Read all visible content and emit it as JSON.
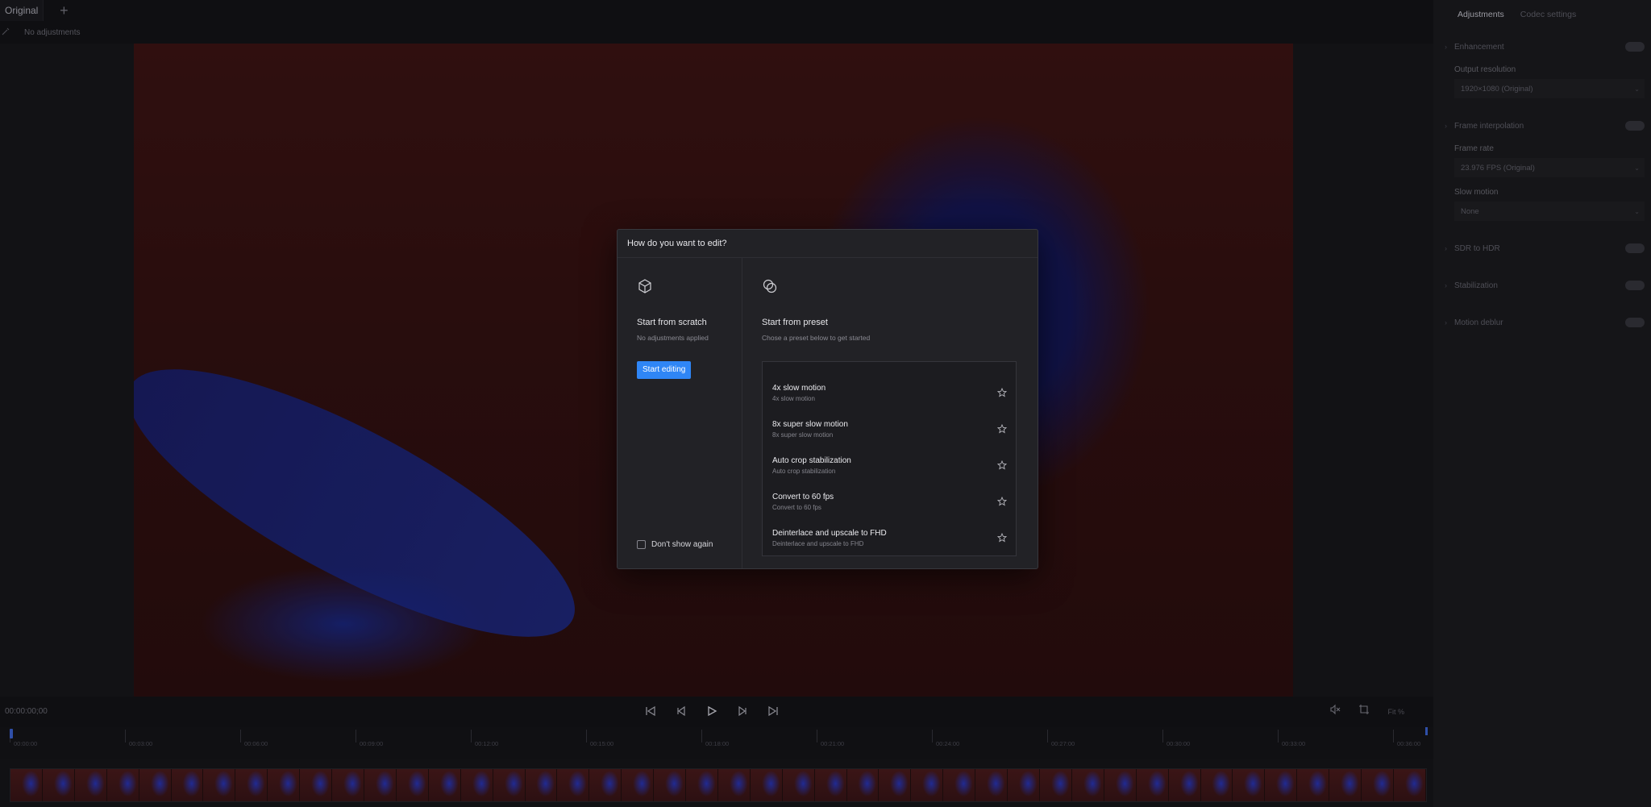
{
  "tabs": {
    "original_label": "Original",
    "add_symbol": "+"
  },
  "subbar": {
    "adjustments_label": "No adjustments"
  },
  "dialog": {
    "title": "How do you want to edit?",
    "scratch": {
      "title": "Start from scratch",
      "subtitle": "No adjustments applied",
      "button": "Start editing",
      "icon": "cube-icon"
    },
    "preset": {
      "title": "Start from preset",
      "subtitle": "Chose a preset below to get started",
      "icon": "circles-icon",
      "items": [
        {
          "name": "4x slow motion",
          "desc": "4x slow motion"
        },
        {
          "name": "8x super slow motion",
          "desc": "8x super slow motion"
        },
        {
          "name": "Auto crop stabilization",
          "desc": "Auto crop stabilization"
        },
        {
          "name": "Convert to 60 fps",
          "desc": "Convert to 60 fps"
        },
        {
          "name": "Deinterlace and upscale to FHD",
          "desc": "Deinterlace and upscale to FHD"
        }
      ]
    },
    "dont_show_label": "Don't show again"
  },
  "panel": {
    "tabs": [
      "Adjustments",
      "Codec settings"
    ],
    "enhancement": "Enhancement",
    "output_resolution_label": "Output resolution",
    "output_resolution_value": "1920×1080 (Original)",
    "frame_interpolation": "Frame interpolation",
    "frame_rate_label": "Frame rate",
    "frame_rate_value": "23.976 FPS (Original)",
    "slow_motion_label": "Slow motion",
    "slow_motion_value": "None",
    "sdr_to_hdr": "SDR to HDR",
    "stabilization": "Stabilization",
    "motion_deblur": "Motion deblur"
  },
  "transport": {
    "timecode": "00:00:00;00",
    "zoom": "Fit %"
  },
  "timeline": {
    "ticks": [
      "00:00:00",
      "00:03:00",
      "00:06:00",
      "00:09:00",
      "00:12:00",
      "00:15:00",
      "00:18:00",
      "00:21:00",
      "00:24:00",
      "00:27:00",
      "00:30:00",
      "00:33:00",
      "00:36:00"
    ]
  },
  "colors": {
    "accent": "#2f86f6",
    "dialog_bg": "#222226",
    "panel_bg": "#151518"
  }
}
